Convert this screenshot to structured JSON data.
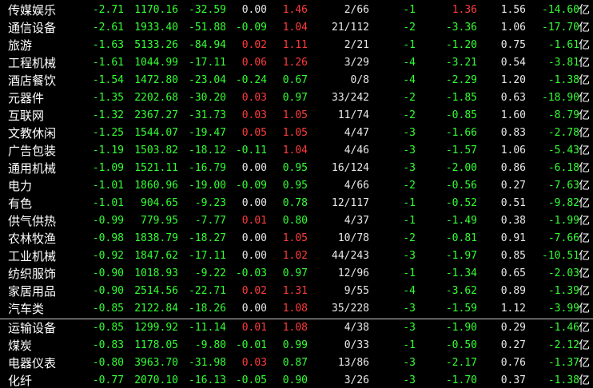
{
  "colors": {
    "background": "#000000",
    "rise": "#ff3b3b",
    "fall": "#33ff33",
    "flat": "#e8e8e8",
    "text": "#ffffff"
  },
  "unit_label": "亿",
  "rows": [
    {
      "name": "传媒娱乐",
      "c1": "-2.71",
      "c2": "1170.16",
      "c3": "-32.59",
      "c4": "0.00",
      "c5": "1.46",
      "c6": "2/66",
      "c7": "-1",
      "c8": "1.36",
      "c9": "1.56",
      "c10": "-14.60",
      "c4c": "white",
      "c5c": "red",
      "c8c": "red"
    },
    {
      "name": "通信设备",
      "c1": "-2.61",
      "c2": "1933.40",
      "c3": "-51.88",
      "c4": "-0.09",
      "c5": "1.04",
      "c6": "21/112",
      "c7": "-2",
      "c8": "-3.36",
      "c9": "1.06",
      "c10": "-17.70",
      "c4c": "green",
      "c5c": "red",
      "c8c": "green"
    },
    {
      "name": "旅游",
      "c1": "-1.63",
      "c2": "5133.26",
      "c3": "-84.94",
      "c4": "0.02",
      "c5": "1.11",
      "c6": "2/21",
      "c7": "-1",
      "c8": "-1.20",
      "c9": "0.75",
      "c10": "-1.61",
      "c4c": "red",
      "c5c": "red",
      "c8c": "green"
    },
    {
      "name": "工程机械",
      "c1": "-1.61",
      "c2": "1044.99",
      "c3": "-17.11",
      "c4": "0.06",
      "c5": "1.26",
      "c6": "3/29",
      "c7": "-4",
      "c8": "-3.21",
      "c9": "0.54",
      "c10": "-3.81",
      "c4c": "red",
      "c5c": "red",
      "c8c": "green"
    },
    {
      "name": "酒店餐饮",
      "c1": "-1.54",
      "c2": "1472.80",
      "c3": "-23.04",
      "c4": "-0.24",
      "c5": "0.67",
      "c6": "0/8",
      "c7": "-4",
      "c8": "-2.29",
      "c9": "1.20",
      "c10": "-1.38",
      "c4c": "green",
      "c5c": "green",
      "c8c": "green"
    },
    {
      "name": "元器件",
      "c1": "-1.35",
      "c2": "2202.68",
      "c3": "-30.20",
      "c4": "0.03",
      "c5": "0.97",
      "c6": "33/242",
      "c7": "-2",
      "c8": "-1.85",
      "c9": "0.63",
      "c10": "-18.90",
      "c4c": "red",
      "c5c": "green",
      "c8c": "green"
    },
    {
      "name": "互联网",
      "c1": "-1.32",
      "c2": "2367.27",
      "c3": "-31.73",
      "c4": "0.03",
      "c5": "1.05",
      "c6": "11/74",
      "c7": "-2",
      "c8": "-0.85",
      "c9": "1.60",
      "c10": "-8.79",
      "c4c": "red",
      "c5c": "red",
      "c8c": "green"
    },
    {
      "name": "文教休闲",
      "c1": "-1.25",
      "c2": "1544.07",
      "c3": "-19.47",
      "c4": "0.05",
      "c5": "1.05",
      "c6": "4/47",
      "c7": "-3",
      "c8": "-1.66",
      "c9": "0.83",
      "c10": "-2.78",
      "c4c": "red",
      "c5c": "red",
      "c8c": "green"
    },
    {
      "name": "广告包装",
      "c1": "-1.19",
      "c2": "1503.82",
      "c3": "-18.12",
      "c4": "-0.11",
      "c5": "1.04",
      "c6": "4/46",
      "c7": "-3",
      "c8": "-1.57",
      "c9": "1.06",
      "c10": "-5.43",
      "c4c": "green",
      "c5c": "red",
      "c8c": "green"
    },
    {
      "name": "通用机械",
      "c1": "-1.09",
      "c2": "1521.11",
      "c3": "-16.79",
      "c4": "0.00",
      "c5": "0.95",
      "c6": "16/124",
      "c7": "-3",
      "c8": "-2.00",
      "c9": "0.86",
      "c10": "-6.18",
      "c4c": "white",
      "c5c": "green",
      "c8c": "green"
    },
    {
      "name": "电力",
      "c1": "-1.01",
      "c2": "1860.96",
      "c3": "-19.00",
      "c4": "-0.09",
      "c5": "0.95",
      "c6": "4/66",
      "c7": "-2",
      "c8": "-0.56",
      "c9": "0.27",
      "c10": "-7.63",
      "c4c": "green",
      "c5c": "green",
      "c8c": "green"
    },
    {
      "name": "有色",
      "c1": "-1.01",
      "c2": "904.65",
      "c3": "-9.23",
      "c4": "0.00",
      "c5": "0.78",
      "c6": "12/117",
      "c7": "-1",
      "c8": "-0.52",
      "c9": "0.51",
      "c10": "-9.82",
      "c4c": "white",
      "c5c": "green",
      "c8c": "green"
    },
    {
      "name": "供气供热",
      "c1": "-0.99",
      "c2": "779.95",
      "c3": "-7.77",
      "c4": "0.01",
      "c5": "0.80",
      "c6": "4/37",
      "c7": "-1",
      "c8": "-1.49",
      "c9": "0.38",
      "c10": "-1.99",
      "c4c": "red",
      "c5c": "green",
      "c8c": "green"
    },
    {
      "name": "农林牧渔",
      "c1": "-0.98",
      "c2": "1838.79",
      "c3": "-18.27",
      "c4": "0.00",
      "c5": "1.05",
      "c6": "10/78",
      "c7": "-2",
      "c8": "-0.81",
      "c9": "0.91",
      "c10": "-7.66",
      "c4c": "white",
      "c5c": "red",
      "c8c": "green"
    },
    {
      "name": "工业机械",
      "c1": "-0.92",
      "c2": "1847.62",
      "c3": "-17.11",
      "c4": "0.00",
      "c5": "1.02",
      "c6": "44/243",
      "c7": "-3",
      "c8": "-1.97",
      "c9": "0.85",
      "c10": "-10.51",
      "c4c": "white",
      "c5c": "red",
      "c8c": "green"
    },
    {
      "name": "纺织服饰",
      "c1": "-0.90",
      "c2": "1018.93",
      "c3": "-9.22",
      "c4": "-0.03",
      "c5": "0.97",
      "c6": "12/96",
      "c7": "-1",
      "c8": "-1.34",
      "c9": "0.65",
      "c10": "-2.03",
      "c4c": "green",
      "c5c": "green",
      "c8c": "green"
    },
    {
      "name": "家居用品",
      "c1": "-0.90",
      "c2": "2514.56",
      "c3": "-22.71",
      "c4": "0.02",
      "c5": "1.31",
      "c6": "9/55",
      "c7": "-4",
      "c8": "-3.62",
      "c9": "0.89",
      "c10": "-1.39",
      "c4c": "red",
      "c5c": "red",
      "c8c": "green"
    },
    {
      "name": "汽车类",
      "c1": "-0.85",
      "c2": "2122.84",
      "c3": "-18.26",
      "c4": "0.00",
      "c5": "1.08",
      "c6": "35/228",
      "c7": "-3",
      "c8": "-1.59",
      "c9": "1.12",
      "c10": "-3.99",
      "c4c": "white",
      "c5c": "red",
      "c8c": "green"
    },
    {
      "name": "运输设备",
      "c1": "-0.85",
      "c2": "1299.92",
      "c3": "-11.14",
      "c4": "0.01",
      "c5": "1.08",
      "c6": "4/38",
      "c7": "-3",
      "c8": "-1.90",
      "c9": "0.29",
      "c10": "-1.46",
      "c4c": "red",
      "c5c": "red",
      "c8c": "green"
    },
    {
      "name": "煤炭",
      "c1": "-0.83",
      "c2": "1178.05",
      "c3": "-9.80",
      "c4": "-0.01",
      "c5": "0.99",
      "c6": "0/33",
      "c7": "-1",
      "c8": "-0.50",
      "c9": "0.27",
      "c10": "-2.12",
      "c4c": "green",
      "c5c": "green",
      "c8c": "green"
    },
    {
      "name": "电器仪表",
      "c1": "-0.80",
      "c2": "3963.70",
      "c3": "-31.98",
      "c4": "0.03",
      "c5": "0.87",
      "c6": "13/86",
      "c7": "-3",
      "c8": "-2.17",
      "c9": "0.76",
      "c10": "-1.37",
      "c4c": "red",
      "c5c": "green",
      "c8c": "green"
    },
    {
      "name": "化纤",
      "c1": "-0.77",
      "c2": "2070.10",
      "c3": "-16.13",
      "c4": "-0.05",
      "c5": "0.90",
      "c6": "3/26",
      "c7": "-3",
      "c8": "-1.70",
      "c9": "0.37",
      "c10": "-1.38",
      "c4c": "green",
      "c5c": "green",
      "c8c": "green"
    }
  ]
}
